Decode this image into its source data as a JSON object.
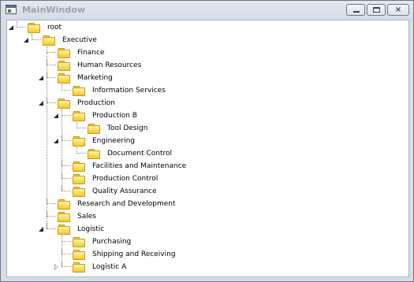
{
  "window": {
    "title": "MainWindow",
    "icon": "app-window-icon",
    "buttons": [
      {
        "name": "minimize-button",
        "icon": "minimize-icon"
      },
      {
        "name": "maximize-button",
        "icon": "maximize-icon"
      },
      {
        "name": "close-button",
        "icon": "close-icon",
        "glyph": "×"
      }
    ]
  },
  "tree": {
    "nodes": [
      {
        "id": "root",
        "label": "root",
        "level": 0,
        "state": "expanded"
      },
      {
        "id": "executive",
        "label": "Executive",
        "level": 1,
        "state": "expanded"
      },
      {
        "id": "finance",
        "label": "Finance",
        "level": 2,
        "state": "leaf"
      },
      {
        "id": "human-resources",
        "label": "Human Resources",
        "level": 2,
        "state": "leaf"
      },
      {
        "id": "marketing",
        "label": "Marketing",
        "level": 2,
        "state": "expanded"
      },
      {
        "id": "information-services",
        "label": "Information Services",
        "level": 3,
        "state": "leaf"
      },
      {
        "id": "production",
        "label": "Production",
        "level": 2,
        "state": "expanded"
      },
      {
        "id": "production-b",
        "label": "Production B",
        "level": 3,
        "state": "expanded"
      },
      {
        "id": "tool-design",
        "label": "Tool Design",
        "level": 4,
        "state": "leaf"
      },
      {
        "id": "engineering",
        "label": "Engineering",
        "level": 3,
        "state": "expanded"
      },
      {
        "id": "document-control",
        "label": "Document Control",
        "level": 4,
        "state": "leaf"
      },
      {
        "id": "facilities-and-maintenance",
        "label": "Facilities and Maintenance",
        "level": 3,
        "state": "leaf"
      },
      {
        "id": "production-control",
        "label": "Production Control",
        "level": 3,
        "state": "leaf"
      },
      {
        "id": "quality-assurance",
        "label": "Quality Assurance",
        "level": 3,
        "state": "leaf"
      },
      {
        "id": "research-and-development",
        "label": "Research and Development",
        "level": 2,
        "state": "leaf"
      },
      {
        "id": "sales",
        "label": "Sales",
        "level": 2,
        "state": "leaf"
      },
      {
        "id": "logistic",
        "label": "Logistic",
        "level": 2,
        "state": "expanded"
      },
      {
        "id": "purchasing",
        "label": "Purchasing",
        "level": 3,
        "state": "leaf"
      },
      {
        "id": "shipping-and-receiving",
        "label": "Shipping and Receiving",
        "level": 3,
        "state": "leaf"
      },
      {
        "id": "logistic-a",
        "label": "Logistic A",
        "level": 3,
        "state": "collapsed"
      }
    ]
  }
}
